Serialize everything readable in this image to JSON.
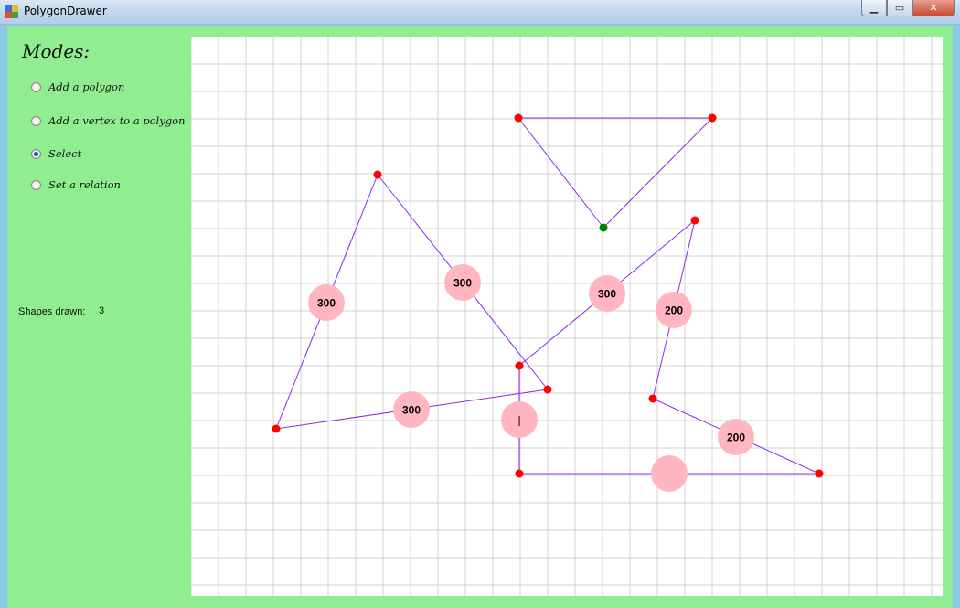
{
  "window": {
    "title": "PolygonDrawer",
    "controls": [
      "minimize",
      "maximize",
      "close"
    ]
  },
  "sidebar": {
    "modes_title": "Modes:",
    "modes": [
      {
        "label": "Add a polygon",
        "checked": false
      },
      {
        "label": "Add a vertex to a polygon",
        "checked": false
      },
      {
        "label": "Select",
        "checked": true
      },
      {
        "label": "Set a relation",
        "checked": false
      }
    ],
    "shapes_label": "Shapes drawn:",
    "shapes_count": "3"
  },
  "canvas": {
    "grid_color": "#d3d3d3",
    "edge_color": "#8a2be2",
    "vertex_color": "#ff0000",
    "selected_vertex_color": "#008000",
    "label_bg": "#ffb6c1",
    "edge_labels": [
      {
        "id": "p1-left",
        "text": "300"
      },
      {
        "id": "p1-mid",
        "text": "300"
      },
      {
        "id": "p2-upper",
        "text": "300"
      },
      {
        "id": "p1-bottom",
        "text": "300"
      },
      {
        "id": "p3-right",
        "text": "200"
      },
      {
        "id": "p3-lower",
        "text": "200"
      },
      {
        "id": "p2-vertical",
        "text": "|"
      },
      {
        "id": "p2-horizontal",
        "text": "—"
      }
    ]
  }
}
